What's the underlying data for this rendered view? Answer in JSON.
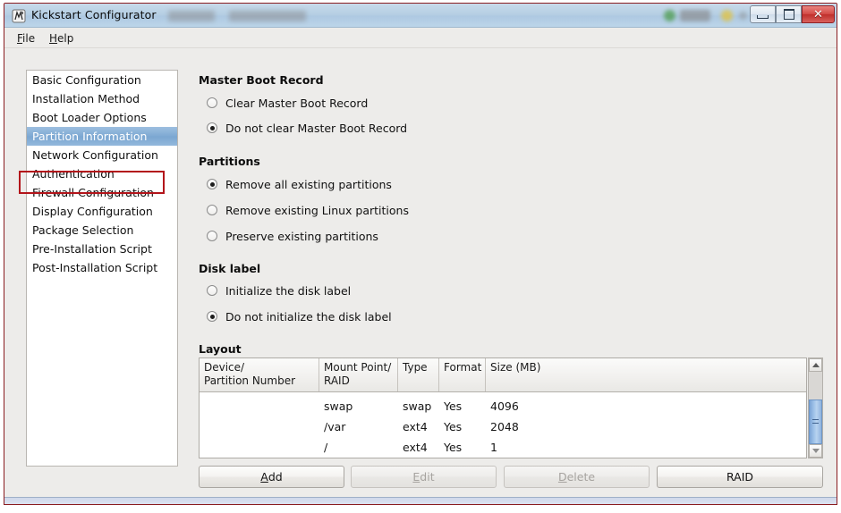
{
  "window": {
    "title": "Kickstart Configurator",
    "icon": "kickstart-app-icon",
    "controls": {
      "minimize": "minimize-button",
      "maximize": "maximize-button",
      "close_glyph": "✕"
    }
  },
  "menubar": {
    "items": [
      {
        "label": "File",
        "mnemonic": "F"
      },
      {
        "label": "Help",
        "mnemonic": "H"
      }
    ]
  },
  "sidebar": {
    "selected_index": 3,
    "items": [
      {
        "label": "Basic Configuration"
      },
      {
        "label": "Installation Method"
      },
      {
        "label": "Boot Loader Options"
      },
      {
        "label": "Partition Information"
      },
      {
        "label": "Network Configuration"
      },
      {
        "label": "Authentication"
      },
      {
        "label": "Firewall Configuration"
      },
      {
        "label": "Display Configuration"
      },
      {
        "label": "Package Selection"
      },
      {
        "label": "Pre-Installation Script"
      },
      {
        "label": "Post-Installation Script"
      }
    ]
  },
  "annotation": {
    "color": "#b3141a",
    "target": "Partition Information"
  },
  "content": {
    "mbr": {
      "title": "Master Boot Record",
      "options": [
        {
          "label": "Clear Master Boot Record",
          "selected": false
        },
        {
          "label": "Do not clear Master Boot Record",
          "selected": true
        }
      ]
    },
    "partitions": {
      "title": "Partitions",
      "options": [
        {
          "label": "Remove all existing partitions",
          "selected": true
        },
        {
          "label": "Remove existing Linux partitions",
          "selected": false
        },
        {
          "label": "Preserve existing partitions",
          "selected": false
        }
      ]
    },
    "disk_label": {
      "title": "Disk label",
      "options": [
        {
          "label": "Initialize the disk label",
          "selected": false
        },
        {
          "label": "Do not initialize the disk label",
          "selected": true
        }
      ]
    },
    "layout": {
      "title": "Layout",
      "columns": [
        "Device/\nPartition Number",
        "Mount Point/\nRAID",
        "Type",
        "Format",
        "Size (MB)"
      ],
      "rows": [
        {
          "device": "",
          "mount": "swap",
          "type": "swap",
          "format": "Yes",
          "size": "4096"
        },
        {
          "device": "",
          "mount": "/var",
          "type": "ext4",
          "format": "Yes",
          "size": "2048"
        },
        {
          "device": "",
          "mount": "/",
          "type": "ext4",
          "format": "Yes",
          "size": "1"
        }
      ],
      "scrollbar": {
        "up_icon": "scroll-up-arrow-icon",
        "down_icon": "scroll-down-arrow-icon"
      }
    },
    "buttons": [
      {
        "label": "Add",
        "mnemonic": "A",
        "enabled": true
      },
      {
        "label": "Edit",
        "mnemonic": "E",
        "enabled": false
      },
      {
        "label": "Delete",
        "mnemonic": "D",
        "enabled": false
      },
      {
        "label": "RAID",
        "mnemonic": "",
        "enabled": true
      }
    ]
  },
  "colors": {
    "selection": "#7ea9d3",
    "annotation": "#b3141a",
    "window_border": "#8a1c20",
    "chrome": "#edecea"
  }
}
